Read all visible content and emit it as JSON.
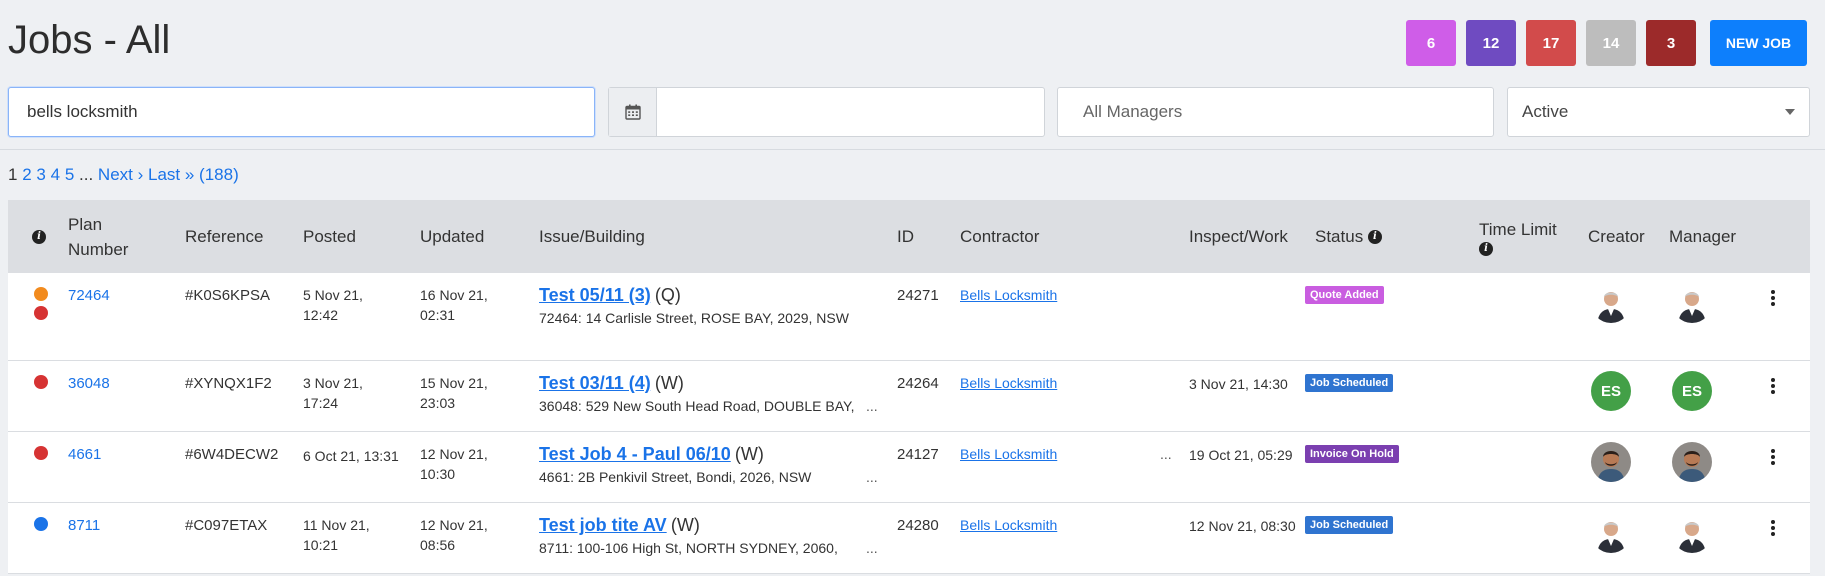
{
  "page": {
    "title": "Jobs - All"
  },
  "header_badges": [
    {
      "count": "6",
      "color": "#cf5de8"
    },
    {
      "count": "12",
      "color": "#6f4bc1"
    },
    {
      "count": "17",
      "color": "#d24b4b"
    },
    {
      "count": "14",
      "color": "#bdbdbd"
    },
    {
      "count": "3",
      "color": "#9c2a2a"
    }
  ],
  "new_job_label": "NEW JOB",
  "filters": {
    "search_value": "bells locksmith",
    "date_value": "",
    "managers_placeholder": "All Managers",
    "status_selected": "Active"
  },
  "pager": {
    "current": "1",
    "pages": [
      "2",
      "3",
      "4",
      "5"
    ],
    "dots": "...",
    "next": "Next ›",
    "last": "Last »",
    "total": "(188)"
  },
  "columns": {
    "plan": "Plan Number",
    "reference": "Reference",
    "posted": "Posted",
    "updated": "Updated",
    "issue": "Issue/Building",
    "id": "ID",
    "contractor": "Contractor",
    "inspect": "Inspect/Work",
    "status": "Status",
    "time_limit": "Time Limit",
    "creator": "Creator",
    "manager": "Manager"
  },
  "rows": [
    {
      "dots": [
        "#f28b1e",
        "#d63333"
      ],
      "plan": "72464",
      "reference": "#K0S6KPSA",
      "posted_1": "5 Nov 21,",
      "posted_2": "12:42",
      "updated_1": "16 Nov 21,",
      "updated_2": "02:31",
      "issue_title": "Test 05/11 (3)",
      "issue_type": "(Q)",
      "address": "72464: 14 Carlisle Street, ROSE BAY, 2029, NSW",
      "address_more": "",
      "id": "24271",
      "contractor": "Bells Locksmith",
      "contractor_more": "",
      "inspect": "",
      "status": "Quote Added",
      "status_color": "#c95de0",
      "creator_initials": "",
      "manager_initials": ""
    },
    {
      "dots": [
        "#d63333"
      ],
      "plan": "36048",
      "reference": "#XYNQX1F2",
      "posted_1": "3 Nov 21,",
      "posted_2": "17:24",
      "updated_1": "15 Nov 21,",
      "updated_2": "23:03",
      "issue_title": "Test 03/11 (4)",
      "issue_type": "(W)",
      "address": "36048: 529 New South Head Road, DOUBLE BAY,",
      "address_more": "...",
      "id": "24264",
      "contractor": "Bells Locksmith",
      "contractor_more": "",
      "inspect": "3 Nov 21, 14:30",
      "status": "Job Scheduled",
      "status_color": "#2f74d0",
      "creator_initials": "ES",
      "manager_initials": "ES"
    },
    {
      "dots": [
        "#d63333"
      ],
      "plan": "4661",
      "reference": "#6W4DECW2",
      "posted_1": "6 Oct 21, 13:31",
      "posted_2": "",
      "updated_1": "12 Nov 21,",
      "updated_2": "10:30",
      "issue_title": "Test Job 4 - Paul 06/10",
      "issue_type": "(W)",
      "address": "4661: 2B Penkivil Street, Bondi, 2026, NSW",
      "address_more": "...",
      "id": "24127",
      "contractor": "Bells Locksmith",
      "contractor_more": "...",
      "inspect": "19 Oct 21, 05:29",
      "status": "Invoice On Hold",
      "status_color": "#7b3fb0",
      "creator_initials": "",
      "manager_initials": ""
    },
    {
      "dots": [
        "#1a73e8"
      ],
      "plan": "8711",
      "reference": "#C097ETAX",
      "posted_1": "11 Nov 21,",
      "posted_2": "10:21",
      "updated_1": "12 Nov 21,",
      "updated_2": "08:56",
      "issue_title": "Test job tite AV",
      "issue_type": "(W)",
      "address": "8711: 100-106 High St, NORTH SYDNEY, 2060,",
      "address_more": "...",
      "id": "24280",
      "contractor": "Bells Locksmith",
      "contractor_more": "",
      "inspect": "12 Nov 21, 08:30",
      "status": "Job Scheduled",
      "status_color": "#2f74d0",
      "creator_initials": "",
      "manager_initials": ""
    }
  ]
}
